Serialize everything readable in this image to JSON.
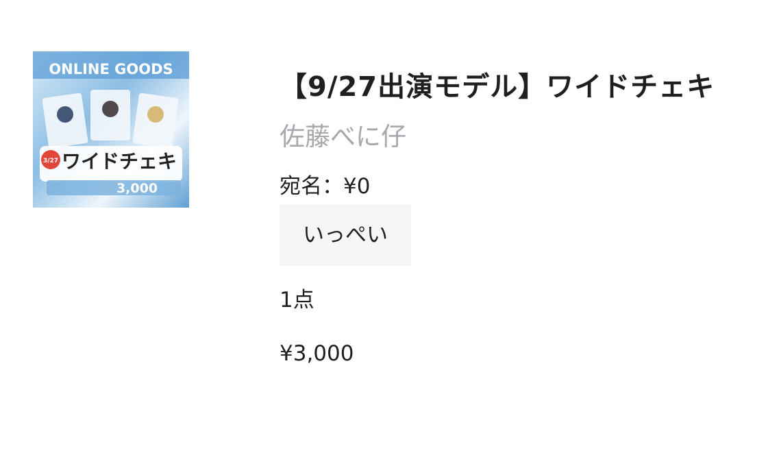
{
  "product": {
    "title": "【9/27出演モデル】ワイドチェキ",
    "seller": "佐藤べに仔",
    "option_label": "宛名：¥0",
    "option_value": "いっぺい",
    "quantity": "1点",
    "price": "¥3,000"
  },
  "thumbnail": {
    "heading": "ONLINE GOODS",
    "product_text": "ワイドチェキ",
    "price_text": "3,000",
    "badge_text": "3/27"
  },
  "colors": {
    "title": "#1f1f1f",
    "seller": "#a7a7ad",
    "chip_bg": "#f6f6f8"
  }
}
